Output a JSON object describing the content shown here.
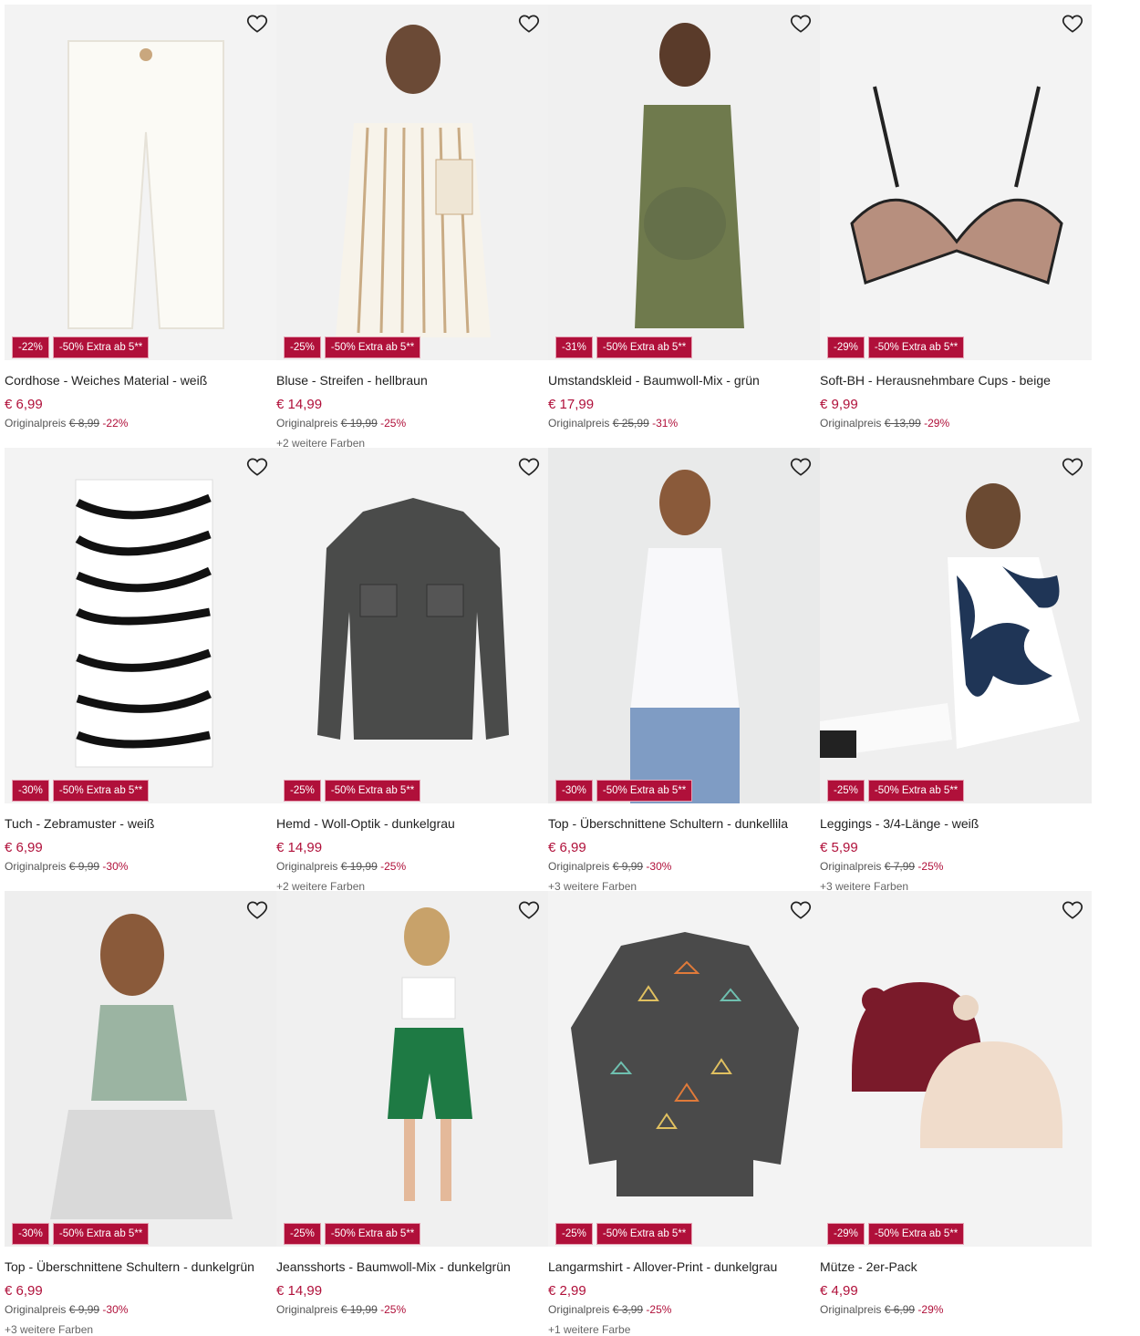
{
  "accent_color": "#b0103a",
  "products": [
    {
      "title": "Cordhose - Weiches Material - weiß",
      "price": "€ 6,99",
      "orig_label": "Originalpreis",
      "orig_price": "€ 8,99",
      "discount": "-22%",
      "badge_discount": "-22%",
      "badge_extra": "-50% Extra ab 5**",
      "more_colors": ""
    },
    {
      "title": "Bluse - Streifen - hellbraun",
      "price": "€ 14,99",
      "orig_label": "Originalpreis",
      "orig_price": "€ 19,99",
      "discount": "-25%",
      "badge_discount": "-25%",
      "badge_extra": "-50% Extra ab 5**",
      "more_colors": "+2 weitere Farben"
    },
    {
      "title": "Umstandskleid - Baumwoll-Mix - grün",
      "price": "€ 17,99",
      "orig_label": "Originalpreis",
      "orig_price": "€ 25,99",
      "discount": "-31%",
      "badge_discount": "-31%",
      "badge_extra": "-50% Extra ab 5**",
      "more_colors": ""
    },
    {
      "title": "Soft-BH - Herausnehmbare Cups - beige",
      "price": "€ 9,99",
      "orig_label": "Originalpreis",
      "orig_price": "€ 13,99",
      "discount": "-29%",
      "badge_discount": "-29%",
      "badge_extra": "-50% Extra ab 5**",
      "more_colors": ""
    },
    {
      "title": "Tuch - Zebramuster - weiß",
      "price": "€ 6,99",
      "orig_label": "Originalpreis",
      "orig_price": "€ 9,99",
      "discount": "-30%",
      "badge_discount": "-30%",
      "badge_extra": "-50% Extra ab 5**",
      "more_colors": ""
    },
    {
      "title": "Hemd - Woll-Optik - dunkelgrau",
      "price": "€ 14,99",
      "orig_label": "Originalpreis",
      "orig_price": "€ 19,99",
      "discount": "-25%",
      "badge_discount": "-25%",
      "badge_extra": "-50% Extra ab 5**",
      "more_colors": "+2 weitere Farben"
    },
    {
      "title": "Top - Überschnittene Schultern - dunkellila",
      "price": "€ 6,99",
      "orig_label": "Originalpreis",
      "orig_price": "€ 9,99",
      "discount": "-30%",
      "badge_discount": "-30%",
      "badge_extra": "-50% Extra ab 5**",
      "more_colors": "+3 weitere Farben"
    },
    {
      "title": "Leggings - 3/4-Länge - weiß",
      "price": "€ 5,99",
      "orig_label": "Originalpreis",
      "orig_price": "€ 7,99",
      "discount": "-25%",
      "badge_discount": "-25%",
      "badge_extra": "-50% Extra ab 5**",
      "more_colors": "+3 weitere Farben"
    },
    {
      "title": "Top - Überschnittene Schultern - dunkelgrün",
      "price": "€ 6,99",
      "orig_label": "Originalpreis",
      "orig_price": "€ 9,99",
      "discount": "-30%",
      "badge_discount": "-30%",
      "badge_extra": "-50% Extra ab 5**",
      "more_colors": "+3 weitere Farben"
    },
    {
      "title": "Jeansshorts - Baumwoll-Mix - dunkelgrün",
      "price": "€ 14,99",
      "orig_label": "Originalpreis",
      "orig_price": "€ 19,99",
      "discount": "-25%",
      "badge_discount": "-25%",
      "badge_extra": "-50% Extra ab 5**",
      "more_colors": ""
    },
    {
      "title": "Langarmshirt - Allover-Print - dunkelgrau",
      "price": "€ 2,99",
      "orig_label": "Originalpreis",
      "orig_price": "€ 3,99",
      "discount": "-25%",
      "badge_discount": "-25%",
      "badge_extra": "-50% Extra ab 5**",
      "more_colors": "+1 weitere Farbe"
    },
    {
      "title": "Mütze - 2er-Pack",
      "price": "€ 4,99",
      "orig_label": "Originalpreis",
      "orig_price": "€ 6,99",
      "discount": "-29%",
      "badge_discount": "-29%",
      "badge_extra": "-50% Extra ab 5**",
      "more_colors": ""
    }
  ]
}
